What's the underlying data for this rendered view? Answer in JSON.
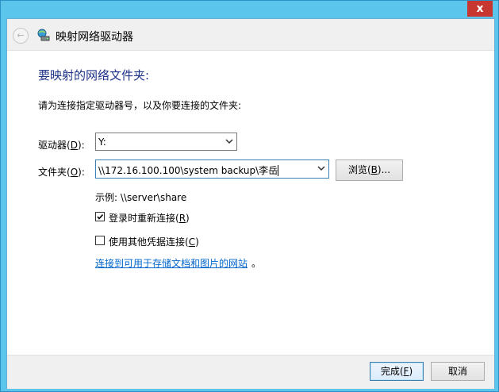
{
  "window": {
    "title": "映射网络驱动器",
    "close_label": "x"
  },
  "icons": {
    "back": "back-arrow-icon",
    "wizard": "network-drive-icon",
    "close": "close-icon",
    "dropdown": "chevron-down-icon",
    "checkmark": "checkmark-icon"
  },
  "content": {
    "heading": "要映射的网络文件夹:",
    "instruction": "请为连接指定驱动器号，以及你要连接的文件夹:",
    "drive_label_main": "驱动器(",
    "drive_label_key": "D",
    "drive_label_end": "):",
    "drive_value": "Y:",
    "folder_label_main": "文件夹(",
    "folder_label_key": "O",
    "folder_label_end": "):",
    "folder_value": "\\\\172.16.100.100\\system backup\\李岳",
    "browse_main": "浏览(",
    "browse_key": "B",
    "browse_end": ")...",
    "example": "示例: \\\\server\\share",
    "reconnect_main": "登录时重新连接(",
    "reconnect_key": "R",
    "reconnect_end": ")",
    "reconnect_checked": true,
    "other_creds_main": "使用其他凭据连接(",
    "other_creds_key": "C",
    "other_creds_end": ")",
    "other_creds_checked": false,
    "link_text": "连接到可用于存储文档和图片的网站",
    "link_suffix": "。"
  },
  "footer": {
    "finish_main": "完成(",
    "finish_key": "F",
    "finish_end": ")",
    "cancel": "取消"
  },
  "colors": {
    "titlebar": "#5cc5ec",
    "close": "#c7372f",
    "heading": "#1e3287",
    "link": "#0066cc"
  }
}
